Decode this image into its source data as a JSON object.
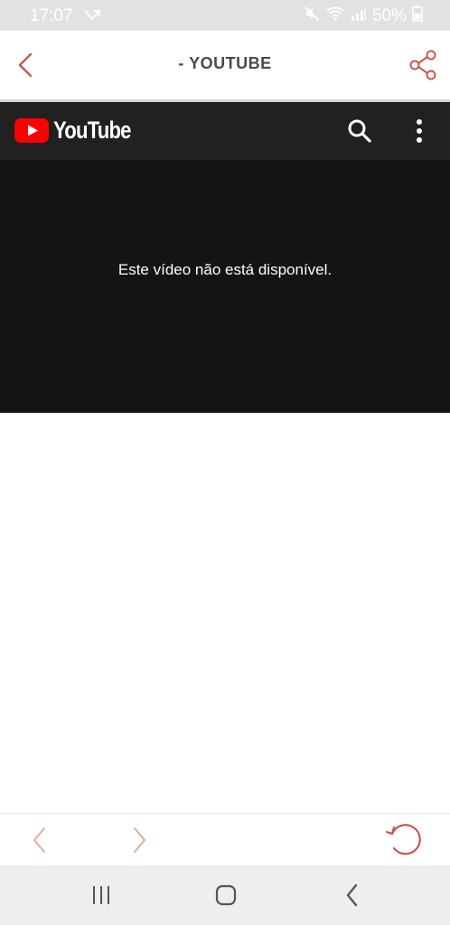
{
  "status_bar": {
    "time": "17:07",
    "battery": "50%",
    "icons": [
      "missed-call-icon",
      "mute-icon",
      "wifi-icon",
      "signal-icon",
      "battery-icon"
    ]
  },
  "header": {
    "title": "- YOUTUBE",
    "back_icon": "chevron-left-icon",
    "share_icon": "share-icon"
  },
  "youtube": {
    "logo_text": "YouTube",
    "search_icon": "search-icon",
    "more_icon": "more-vertical-icon",
    "video_message": "Este vídeo não está disponível."
  },
  "toolbar": {
    "back_icon": "chevron-left-icon",
    "forward_icon": "chevron-right-icon",
    "reload_icon": "reload-icon"
  },
  "nav_bar": {
    "recent_icon": "recent-apps-icon",
    "home_icon": "home-icon",
    "back_icon": "back-icon"
  },
  "colors": {
    "accent": "#c9564f",
    "youtube_red": "#ff0000",
    "youtube_bar": "#212121",
    "video_bg": "#141414",
    "status_bar": "#e2e2e2"
  }
}
